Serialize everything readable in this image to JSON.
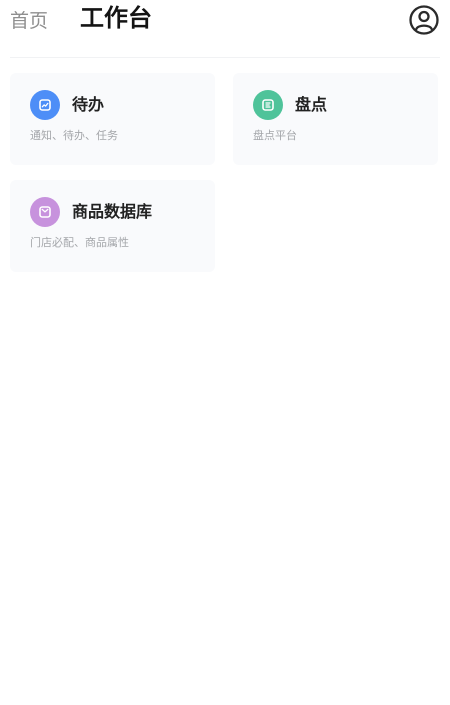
{
  "header": {
    "tab_home": "首页",
    "tab_workbench": "工作台",
    "user_icon": "user-circle-icon"
  },
  "cards": [
    {
      "title": "待办",
      "subtitle": "通知、待办、任务",
      "icon": "todo-icon",
      "color": "#4d8ef7"
    },
    {
      "title": "盘点",
      "subtitle": "盘点平台",
      "icon": "inventory-icon",
      "color": "#4fc39a"
    },
    {
      "title": "商品数据库",
      "subtitle": "门店必配、商品属性",
      "icon": "database-icon",
      "color": "#c792dd"
    }
  ]
}
